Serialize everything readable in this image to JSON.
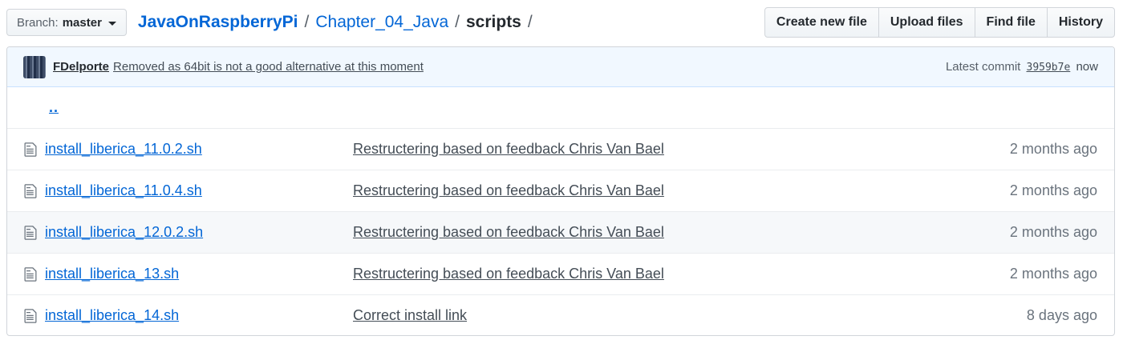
{
  "branch": {
    "label": "Branch:",
    "value": "master"
  },
  "breadcrumb": {
    "repo": "JavaOnRaspberryPi",
    "sep": "/",
    "folder": "Chapter_04_Java",
    "current": "scripts",
    "trailing": "/"
  },
  "actions": {
    "create": "Create new file",
    "upload": "Upload files",
    "find": "Find file",
    "history": "History"
  },
  "commit": {
    "author": "FDelporte",
    "message": "Removed as 64bit is not a good alternative at this moment",
    "latest_label": "Latest commit",
    "sha": "3959b7e",
    "when": "now"
  },
  "files": {
    "parent": "..",
    "rows": [
      {
        "name": "install_liberica_11.0.2.sh",
        "message": "Restructering based on feedback Chris Van Bael",
        "age": "2 months ago"
      },
      {
        "name": "install_liberica_11.0.4.sh",
        "message": "Restructering based on feedback Chris Van Bael",
        "age": "2 months ago"
      },
      {
        "name": "install_liberica_12.0.2.sh",
        "message": "Restructering based on feedback Chris Van Bael",
        "age": "2 months ago"
      },
      {
        "name": "install_liberica_13.sh",
        "message": "Restructering based on feedback Chris Van Bael",
        "age": "2 months ago"
      },
      {
        "name": "install_liberica_14.sh",
        "message": "Correct install link",
        "age": "8 days ago"
      }
    ]
  },
  "colors": {
    "link": "#0366d6",
    "commit_bar_bg": "#f1f8ff",
    "hover_row_bg": "#f6f8fa"
  },
  "icons": {
    "branch_caret": "chevron-down-icon",
    "file": "file-text-icon",
    "avatar": "user-avatar"
  }
}
